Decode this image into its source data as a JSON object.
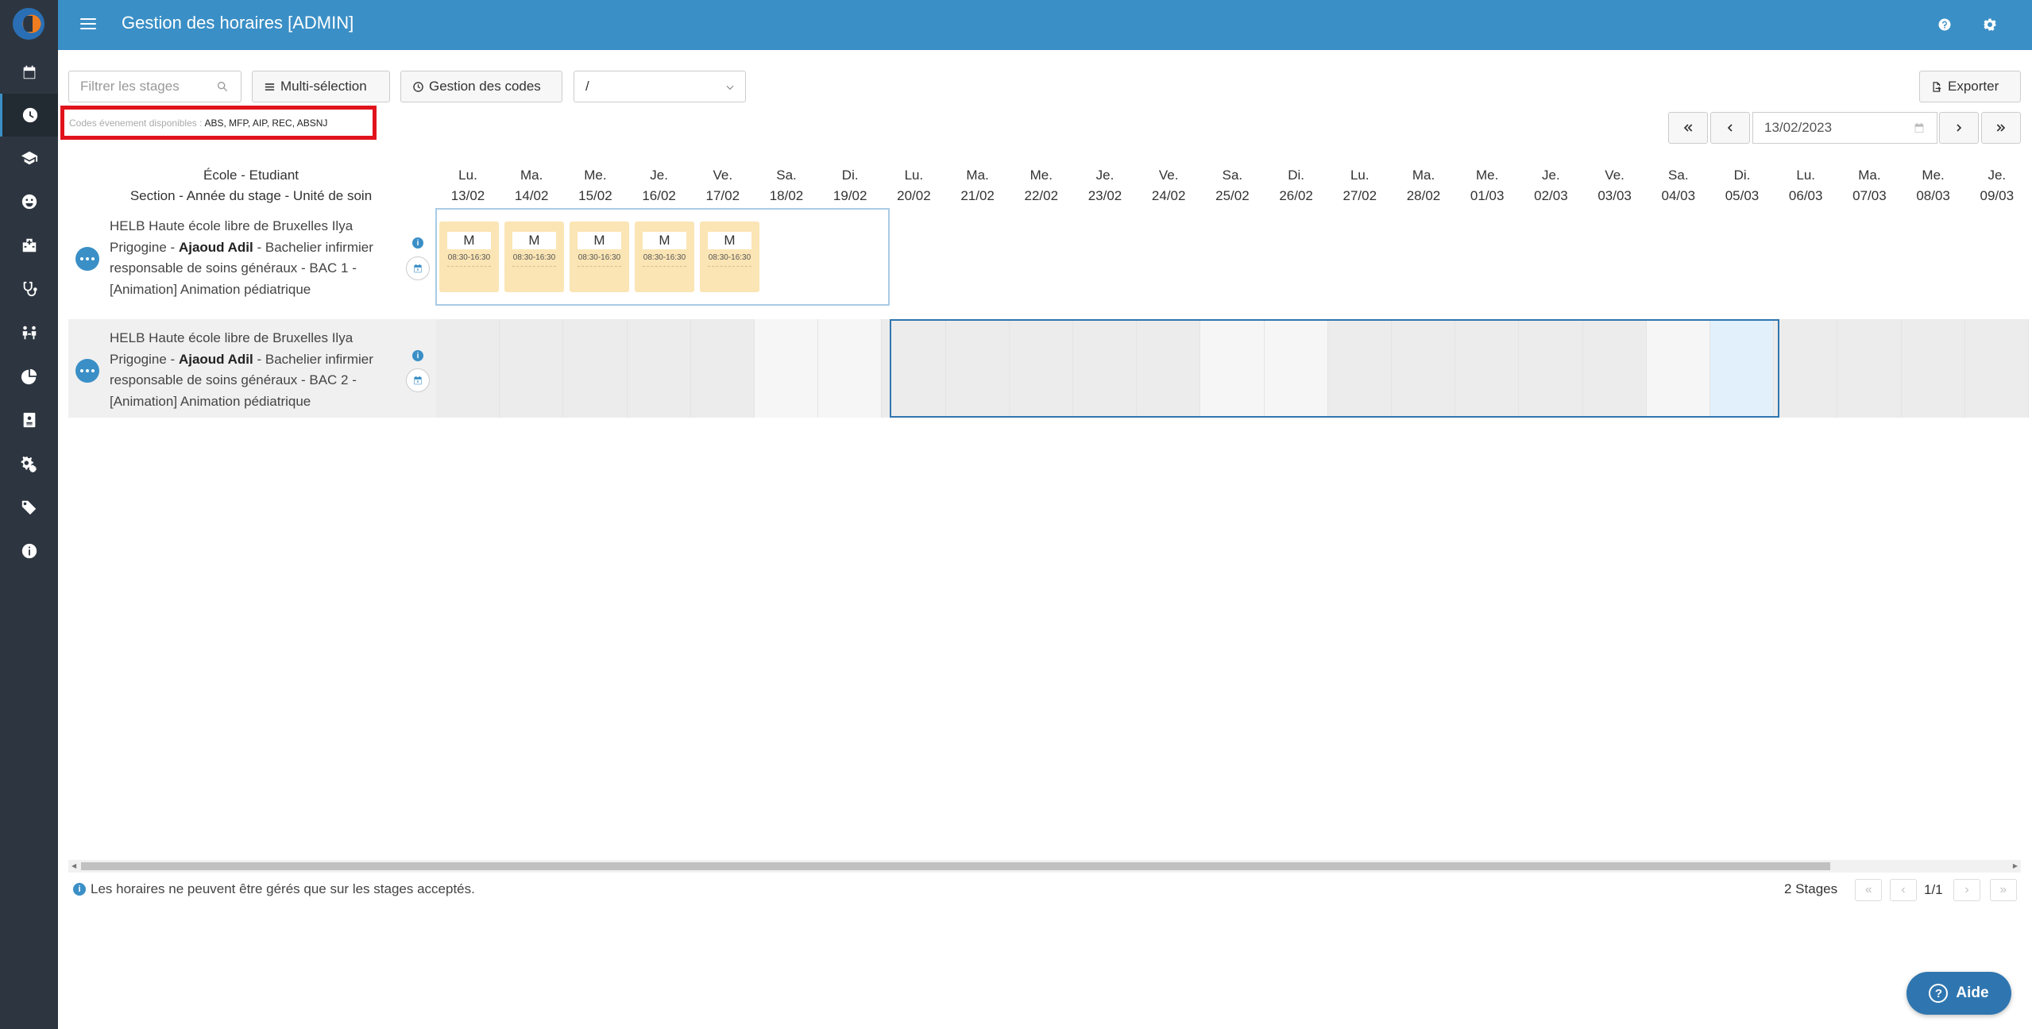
{
  "header": {
    "title": "Gestion des horaires [ADMIN]"
  },
  "sidebar": {
    "icons": [
      "calendar-icon",
      "clock-icon",
      "graduation-cap-icon",
      "smile-icon",
      "hospital-icon",
      "stethoscope-icon",
      "people-icon",
      "pie-chart-icon",
      "id-card-icon",
      "cogs-icon",
      "tags-icon",
      "info-icon"
    ],
    "active": "clock-icon"
  },
  "toolbar": {
    "filter_placeholder": "Filtrer les stages",
    "multi_select_label": "Multi-sélection",
    "codes_management_label": "Gestion des codes",
    "select_value": "/",
    "export_label": "Exporter"
  },
  "codes": {
    "label": "Codes évenement disponibles :",
    "value": "ABS, MFP, AIP, REC, ABSNJ"
  },
  "date_nav": {
    "date": "13/02/2023"
  },
  "grid": {
    "left_header_line1": "École - Etudiant",
    "left_header_line2": "Section - Année du stage - Unité de soin",
    "days": [
      {
        "dow": "Lu.",
        "date": "13/02"
      },
      {
        "dow": "Ma.",
        "date": "14/02"
      },
      {
        "dow": "Me.",
        "date": "15/02"
      },
      {
        "dow": "Je.",
        "date": "16/02"
      },
      {
        "dow": "Ve.",
        "date": "17/02"
      },
      {
        "dow": "Sa.",
        "date": "18/02"
      },
      {
        "dow": "Di.",
        "date": "19/02"
      },
      {
        "dow": "Lu.",
        "date": "20/02"
      },
      {
        "dow": "Ma.",
        "date": "21/02"
      },
      {
        "dow": "Me.",
        "date": "22/02"
      },
      {
        "dow": "Je.",
        "date": "23/02"
      },
      {
        "dow": "Ve.",
        "date": "24/02"
      },
      {
        "dow": "Sa.",
        "date": "25/02"
      },
      {
        "dow": "Di.",
        "date": "26/02"
      },
      {
        "dow": "Lu.",
        "date": "27/02"
      },
      {
        "dow": "Ma.",
        "date": "28/02"
      },
      {
        "dow": "Me.",
        "date": "01/03"
      },
      {
        "dow": "Je.",
        "date": "02/03"
      },
      {
        "dow": "Ve.",
        "date": "03/03"
      },
      {
        "dow": "Sa.",
        "date": "04/03"
      },
      {
        "dow": "Di.",
        "date": "05/03"
      },
      {
        "dow": "Lu.",
        "date": "06/03"
      },
      {
        "dow": "Ma.",
        "date": "07/03"
      },
      {
        "dow": "Me.",
        "date": "08/03"
      },
      {
        "dow": "Je.",
        "date": "09/03"
      }
    ],
    "rows": [
      {
        "school": "HELB Haute école libre de Bruxelles Ilya Prigogine - ",
        "student": "Ajaoud Adil",
        "rest": " - Bachelier infirmier responsable de soins généraux - BAC 1 - [Animation] Animation pédiatrique",
        "shifts": [
          {
            "code": "M",
            "time": "08:30-16:30"
          },
          {
            "code": "M",
            "time": "08:30-16:30"
          },
          {
            "code": "M",
            "time": "08:30-16:30"
          },
          {
            "code": "M",
            "time": "08:30-16:30"
          },
          {
            "code": "M",
            "time": "08:30-16:30"
          }
        ]
      },
      {
        "school": "HELB Haute école libre de Bruxelles Ilya Prigogine - ",
        "student": "Ajaoud Adil",
        "rest": " - Bachelier infirmier responsable de soins généraux - BAC 2 - [Animation] Animation pédiatrique",
        "shifts": []
      }
    ]
  },
  "footer": {
    "note": "Les horaires ne peuvent être gérés que sur les stages acceptés.",
    "count": "2 Stages",
    "page": "1/1"
  },
  "help": {
    "label": "Aide"
  },
  "colors": {
    "primary": "#3a8fc6",
    "sidebar": "#2d3640",
    "shift": "#fbe5b4",
    "highlight_border": "#e1131c"
  }
}
